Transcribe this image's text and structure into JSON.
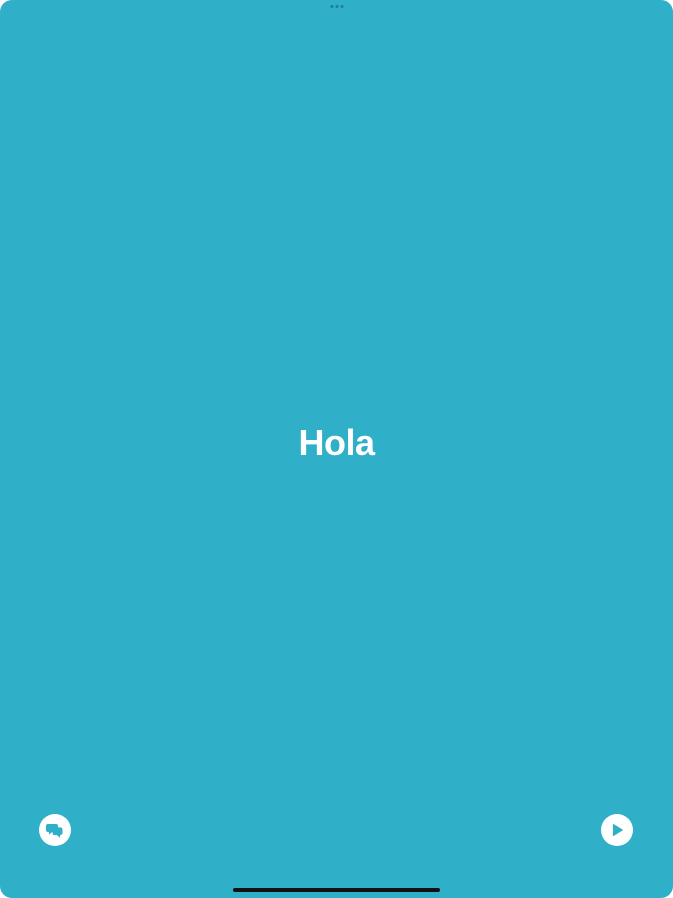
{
  "card": {
    "word": "Hola",
    "background_color": "#30AFC9",
    "text_color": "#FFFFFF"
  },
  "controls": {
    "left_button_icon": "speech-bubbles-icon",
    "right_button_icon": "play-icon",
    "button_color": "#FFFFFF",
    "icon_color": "#30AFC9"
  },
  "chrome": {
    "grabber_color": "#1E7F96",
    "home_indicator_color": "#111111"
  }
}
